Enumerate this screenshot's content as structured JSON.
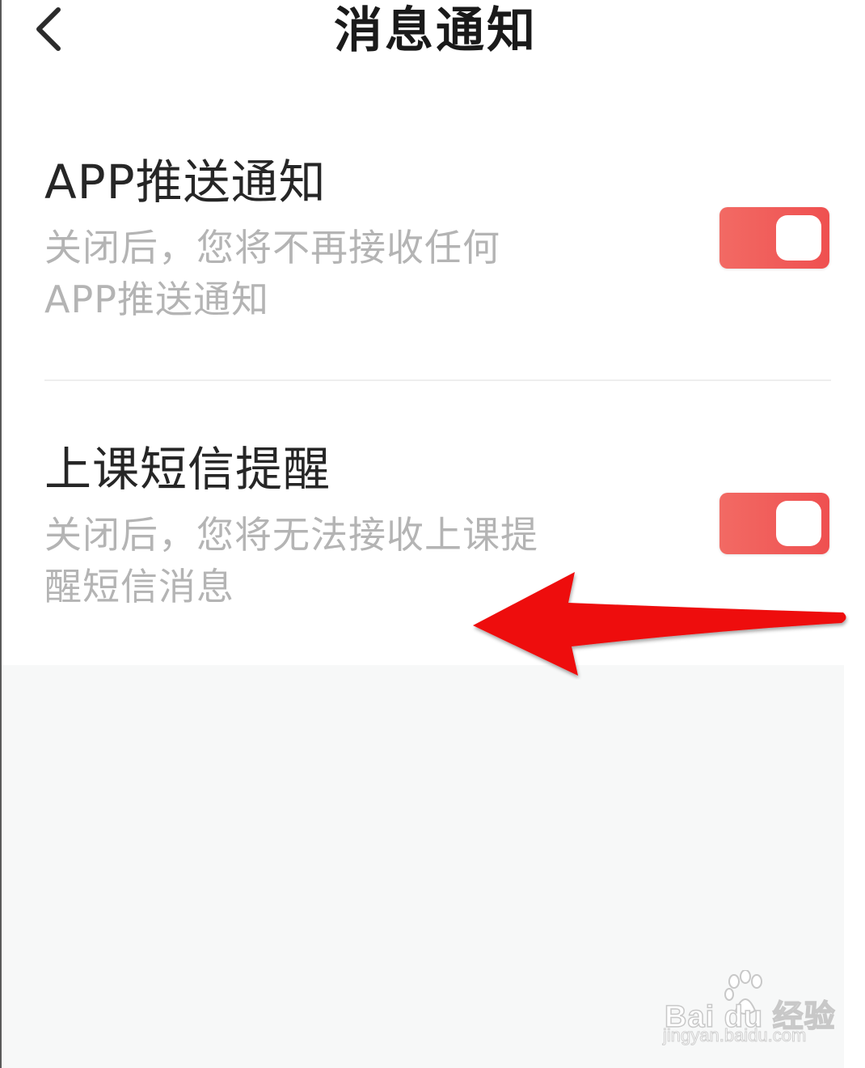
{
  "header": {
    "title": "消息通知",
    "back_icon": "chevron-left-icon"
  },
  "settings": [
    {
      "title": "APP推送通知",
      "description_lines": [
        "关闭后，您将不再接收任何",
        "APP推送通知"
      ],
      "enabled": true
    },
    {
      "title": "上课短信提醒",
      "description_lines": [
        "关闭后，您将无法接收上课提",
        "醒短信消息"
      ],
      "enabled": true
    }
  ],
  "colors": {
    "toggle_on": "#ef5350",
    "annotation_arrow": "#ee0a0a",
    "title_text": "#1a1a1a",
    "description_text": "#b4b4b4"
  },
  "annotation": {
    "icon": "red-arrow-left-icon"
  },
  "watermark": {
    "brand": "Bai du 经验",
    "url": "jingyan.baidu.com",
    "icon": "baidu-paw-icon"
  }
}
